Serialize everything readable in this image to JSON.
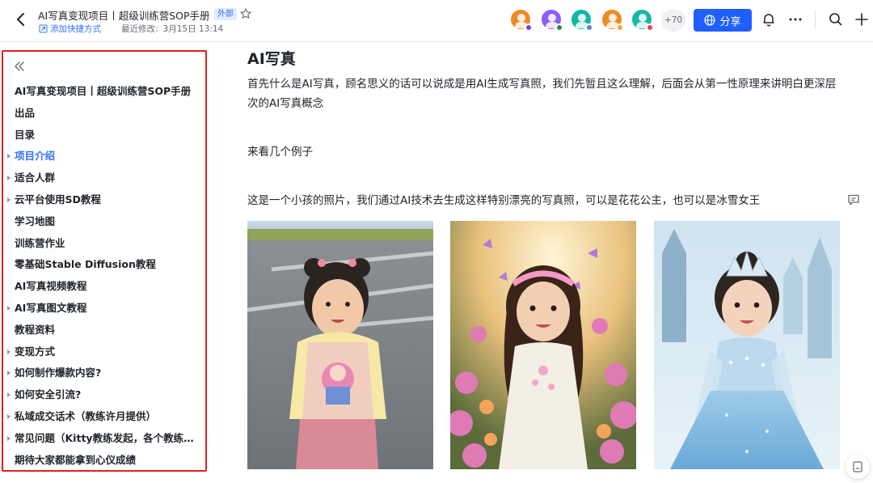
{
  "header": {
    "title": "AI写真变现项目丨超级训练营SOP手册",
    "tag": "外部",
    "shortcut_label": "添加快捷方式",
    "modified_label": "最近修改:",
    "modified_time": "3月15日 13:14",
    "more_count": "+70",
    "share_label": "分享",
    "accent": "#1f5fff",
    "avatars": [
      {
        "bg": "#f08a24",
        "dot": "#7b3fe4"
      },
      {
        "bg": "#8b5cf6",
        "dot": "#1f8a5c"
      },
      {
        "bg": "#14b8a6",
        "dot": "#5b7cfa"
      },
      {
        "bg": "#f08a24",
        "dot": "#f4a64a"
      },
      {
        "bg": "#14b8a6",
        "dot": "#e04848"
      }
    ]
  },
  "sidebar": {
    "items": [
      {
        "label": "AI写真变现项目丨超级训练营SOP手册",
        "caret": false,
        "active": false
      },
      {
        "label": "出品",
        "caret": false,
        "active": false
      },
      {
        "label": "目录",
        "caret": false,
        "active": false
      },
      {
        "label": "项目介绍",
        "caret": true,
        "active": true
      },
      {
        "label": "适合人群",
        "caret": true,
        "active": false
      },
      {
        "label": "云平台使用SD教程",
        "caret": true,
        "active": false
      },
      {
        "label": "学习地图",
        "caret": false,
        "active": false
      },
      {
        "label": "训练营作业",
        "caret": false,
        "active": false
      },
      {
        "label": "零基础Stable Diffusion教程",
        "caret": false,
        "active": false
      },
      {
        "label": "AI写真视频教程",
        "caret": false,
        "active": false
      },
      {
        "label": "AI写真图文教程",
        "caret": true,
        "active": false
      },
      {
        "label": "教程资料",
        "caret": false,
        "active": false
      },
      {
        "label": "变现方式",
        "caret": true,
        "active": false
      },
      {
        "label": "如何制作爆款内容?",
        "caret": true,
        "active": false
      },
      {
        "label": "如何安全引流?",
        "caret": true,
        "active": false
      },
      {
        "label": "私域成交话术（教练许月提供）",
        "caret": true,
        "active": false
      },
      {
        "label": "常见问题（Kitty教练发起，各个教练共同整理）",
        "caret": true,
        "active": false
      },
      {
        "label": "期待大家都能拿到心仪成绩",
        "caret": false,
        "active": false
      }
    ],
    "highlight_color": "#e02020"
  },
  "main": {
    "heading": "AI写真",
    "paragraph1": "首先什么是AI写真，顾名思义的话可以说成是用AI生成写真照，我们先暂且这么理解，后面会从第一性原理来讲明白更深层次的AI写真概念",
    "paragraph2": "来看几个例子",
    "paragraph3": "这是一个小孩的照片，我们通过AI技术去生成这样特别漂亮的写真照，可以是花花公主，也可以是冰雪女王",
    "photos": [
      {
        "name": "original-photo",
        "description": "real photo"
      },
      {
        "name": "flower-princess-photo",
        "description": "flower princess"
      },
      {
        "name": "ice-queen-photo",
        "description": "ice queen"
      }
    ]
  }
}
